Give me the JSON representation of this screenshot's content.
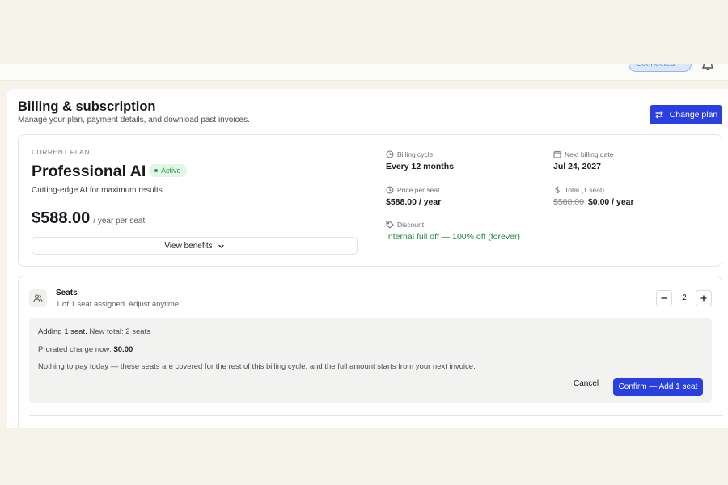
{
  "topbar": {
    "status_label": "Connected",
    "bell_icon": "bell-icon"
  },
  "header": {
    "title": "Billing & subscription",
    "subtitle": "Manage your plan, payment details, and download past invoices.",
    "change_plan_label": "Change plan",
    "change_plan_icon": "swap-arrows-icon"
  },
  "plan": {
    "eyebrow": "CURRENT PLAN",
    "name": "Professional AI",
    "status": "Active",
    "description": "Cutting-edge AI for maximum results.",
    "price": "$588.00",
    "price_unit": "/ year per seat",
    "view_benefits_label": "View benefits"
  },
  "billing_details": {
    "billing_cycle": {
      "label": "Billing cycle",
      "value": "Every 12 months",
      "icon": "clock-icon"
    },
    "next_billing_date": {
      "label": "Next billing date",
      "value": "Jul 24, 2027",
      "icon": "calendar-icon"
    },
    "price_per_seat": {
      "label": "Price per seat",
      "value": "$588.00 / year",
      "icon": "clock-icon"
    },
    "total": {
      "label": "Total (1 seat)",
      "original": "$588.00",
      "value": "$0.00 / year",
      "icon": "dollar-icon"
    },
    "discount": {
      "label": "Discount",
      "value": "Internal full off — 100% off (forever)",
      "icon": "tag-icon"
    }
  },
  "seats": {
    "title": "Seats",
    "subtitle": "1 of 1 seat assigned. Adjust anytime.",
    "count": "2",
    "summary_prefix": "Adding 1 seat.",
    "summary_suffix": "New total: 2 seats",
    "prorated_label": "Prorated charge now:",
    "prorated_value": "$0.00",
    "note": "Nothing to pay today — these seats are covered for the rest of this billing cycle, and the full amount starts from your next invoice.",
    "cancel_label": "Cancel",
    "confirm_label": "Confirm — Add 1 seat"
  },
  "colors": {
    "primary": "#2a3fe0",
    "success": "#1f8a3b",
    "page_bg": "#f6f4ea"
  }
}
